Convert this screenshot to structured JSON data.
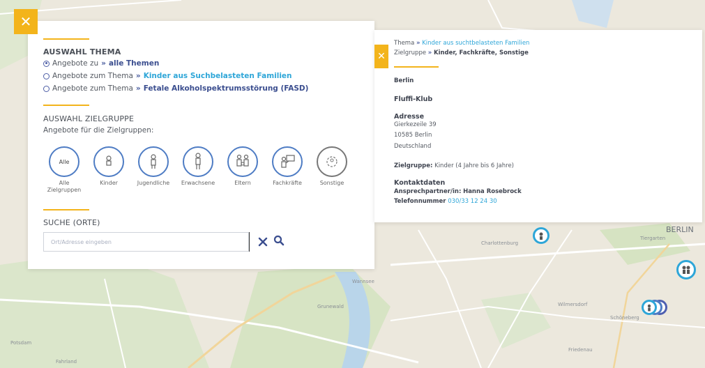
{
  "filter": {
    "close_icon": "close-icon",
    "theme_heading": "AUSWAHL THEMA",
    "theme_options": [
      {
        "prefix": "Angebote zu",
        "arrow": "»",
        "label": "alle Themen",
        "checked": true
      },
      {
        "prefix": "Angebote zum Thema",
        "arrow": "»",
        "label": "Kinder aus Suchbelasteten Familien",
        "checked": false
      },
      {
        "prefix": "Angebote zum Thema",
        "arrow": "»",
        "label": "Fetale Alkoholspektrumsstörung (FASD)",
        "checked": false
      }
    ],
    "group_heading": "AUSWAHL ZIELGRUPPE",
    "group_subtext": "Angebote für die Zielgruppen:",
    "groups": [
      {
        "label": "Alle Zielgruppen",
        "circle_text": "Alle",
        "icon": "all-icon"
      },
      {
        "label": "Kinder",
        "icon": "child-icon"
      },
      {
        "label": "Jugendliche",
        "icon": "teen-icon"
      },
      {
        "label": "Erwachsene",
        "icon": "adult-icon"
      },
      {
        "label": "Eltern",
        "icon": "parents-icon"
      },
      {
        "label": "Fachkräfte",
        "icon": "professionals-icon"
      },
      {
        "label": "Sonstige",
        "icon": "other-icon"
      }
    ],
    "search_heading": "SUCHE (ORTE)",
    "search_placeholder": "Ort/Adresse eingeben",
    "clear_icon": "clear-icon",
    "search_icon": "search-icon"
  },
  "info": {
    "close_icon": "close-icon",
    "theme_prefix": "Thema",
    "theme_arrow": "»",
    "theme_value": "Kinder aus suchtbelasteten Familien",
    "group_prefix": "Zielgruppe",
    "group_arrow": "»",
    "group_value": "Kinder, Fachkräfte, Sonstige",
    "city": "Berlin",
    "name": "Fluffi-Klub",
    "address_label": "Adresse",
    "street": "Gierkezeile 39",
    "zip_city": "10585 Berlin",
    "country": "Deutschland",
    "target_label": "Zielgruppe:",
    "target_value": "Kinder (4 Jahre bis 6 Jahre)",
    "contact_label": "Kontaktdaten",
    "contact_person_label": "Ansprechpartner/in:",
    "contact_person": "Hanna Rosebrock",
    "phone_label": "Telefonnummer",
    "phone": "030/33 12 24 30"
  },
  "map": {
    "labels": [
      {
        "text": "BERLIN"
      },
      {
        "text": "Tiergarten"
      },
      {
        "text": "Wilmersdorf"
      },
      {
        "text": "Schöneberg"
      },
      {
        "text": "Friedenau"
      },
      {
        "text": "Potsdam"
      },
      {
        "text": "Wannsee"
      },
      {
        "text": "Grunewald"
      },
      {
        "text": "Charlottenburg"
      },
      {
        "text": "Fahrland"
      }
    ],
    "marker_icon": "location-marker-icon"
  }
}
